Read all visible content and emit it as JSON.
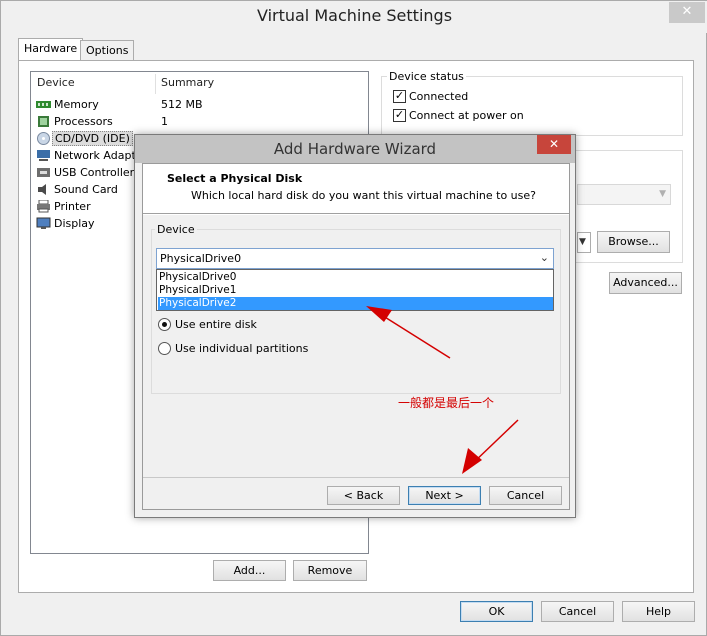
{
  "window": {
    "title": "Virtual Machine Settings",
    "close_glyph": "✕"
  },
  "tabs": [
    {
      "label": "Hardware"
    },
    {
      "label": "Options"
    }
  ],
  "device_list": {
    "header_device": "Device",
    "header_summary": "Summary",
    "items": [
      {
        "label": "Memory",
        "summary": "512 MB",
        "icon": "memory-icon"
      },
      {
        "label": "Processors",
        "summary": "1",
        "icon": "processor-icon"
      },
      {
        "label": "CD/DVD (IDE)",
        "summary": "",
        "icon": "cd-dvd-icon"
      },
      {
        "label": "Network Adapter",
        "summary": "",
        "icon": "network-adapter-icon"
      },
      {
        "label": "USB Controller",
        "summary": "",
        "icon": "usb-controller-icon"
      },
      {
        "label": "Sound Card",
        "summary": "",
        "icon": "sound-card-icon"
      },
      {
        "label": "Printer",
        "summary": "",
        "icon": "printer-icon"
      },
      {
        "label": "Display",
        "summary": "",
        "icon": "display-icon"
      }
    ],
    "add_label": "Add...",
    "remove_label": "Remove"
  },
  "device_status": {
    "legend": "Device status",
    "connected_label": "Connected",
    "connected_checked": true,
    "connect_power_on_label": "Connect at power on",
    "connect_power_on_checked": true
  },
  "right_panel": {
    "browse_label": "Browse...",
    "advanced_label": "Advanced..."
  },
  "footer": {
    "ok_label": "OK",
    "cancel_label": "Cancel",
    "help_label": "Help"
  },
  "wizard": {
    "title": "Add Hardware Wizard",
    "close_glyph": "✕",
    "heading": "Select a Physical Disk",
    "subheading": "Which local hard disk do you want this virtual machine to use?",
    "device_legend": "Device",
    "selected_device": "PhysicalDrive0",
    "options": [
      "PhysicalDrive0",
      "PhysicalDrive1",
      "PhysicalDrive2"
    ],
    "highlighted_option": "PhysicalDrive2",
    "use_entire_disk_label": "Use entire disk",
    "use_partitions_label": "Use individual partitions",
    "selected_usage": "Use entire disk",
    "back_label": "< Back",
    "next_label": "Next >",
    "cancel_label": "Cancel"
  },
  "annotation": {
    "text": "一般都是最后一个",
    "color": "#d40000"
  }
}
